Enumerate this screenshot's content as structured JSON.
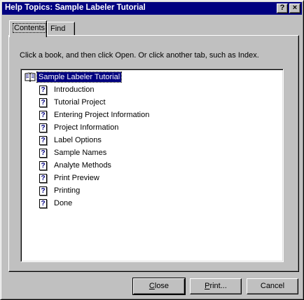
{
  "window": {
    "title": "Help Topics: Sample Labeler Tutorial"
  },
  "titlebar_buttons": {
    "help": "?",
    "close": "×"
  },
  "tabs": [
    {
      "label": "Contents",
      "active": true
    },
    {
      "label": "Find",
      "active": false
    }
  ],
  "instruction": "Click a book, and then click Open. Or click another tab, such as Index.",
  "tree": {
    "root": {
      "label": "Sample Labeler Tutorial",
      "icon": "open-book-icon",
      "selected": true
    },
    "topic_icon": "?",
    "items": [
      "Introduction",
      "Tutorial Project",
      "Entering Project Information",
      "Project Information",
      "Label Options",
      "Sample Names",
      "Analyte Methods",
      "Print Preview",
      "Printing",
      "Done"
    ]
  },
  "buttons": {
    "close": {
      "mnemonic": "C",
      "rest": "lose"
    },
    "print": {
      "mnemonic": "P",
      "rest": "rint..."
    },
    "cancel": "Cancel"
  }
}
